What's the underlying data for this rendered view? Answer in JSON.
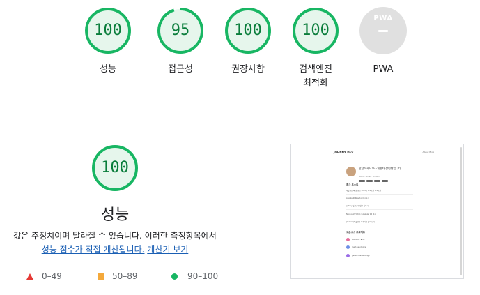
{
  "categories": [
    {
      "score": "100",
      "label": "성능",
      "progress": 1.0
    },
    {
      "score": "95",
      "label": "접근성",
      "progress": 0.95
    },
    {
      "score": "100",
      "label": "권장사항",
      "progress": 1.0
    },
    {
      "score": "100",
      "label": "검색엔진\n최적화",
      "progress": 1.0
    },
    {
      "label": "PWA",
      "logo_text": "PWA"
    }
  ],
  "performance": {
    "score": "100",
    "progress": 1.0,
    "title": "성능",
    "desc_text": "값은 추정치이며 달라질 수 있습니다. 이러한 측정항목에서",
    "link1": "성능 점수가 직접 계산됩니다.",
    "link2": "계산기 보기"
  },
  "legend": [
    {
      "range": "0–49",
      "shape": "triangle",
      "color": "#e53935"
    },
    {
      "range": "50–89",
      "shape": "square",
      "color": "#f4a93b"
    },
    {
      "range": "90–100",
      "shape": "circle",
      "color": "#18b663"
    }
  ],
  "colors": {
    "pass_ring": "#18b663",
    "pass_fill": "#e6f6ec",
    "pass_text": "#0a7d3b"
  },
  "screenshot": {
    "brand": "JOHNNY DEV",
    "nav": "About   Blog",
    "hello": "안녕하세요! FE개발자 장민형입니다",
    "sub": "Github · Email · LinkedIn",
    "section1": "최근 포스트",
    "posts": [
      "개발 회고록 및 회고 2022년 리팩토링 리팩토링",
      "Angular와 React.js 비교하기",
      "gatsby 블로그에 댓글 붙이기",
      "Next.js 13 알아보기 Angular 16 비교",
      "JavaScript 클로저 이해하기 살펴 보기"
    ],
    "section2": "오픈소스 프로젝트",
    "repos": [
      "vue-slot  ·  ★ 21",
      "react-use-hooks",
      "gatsby-starter-tango"
    ]
  }
}
